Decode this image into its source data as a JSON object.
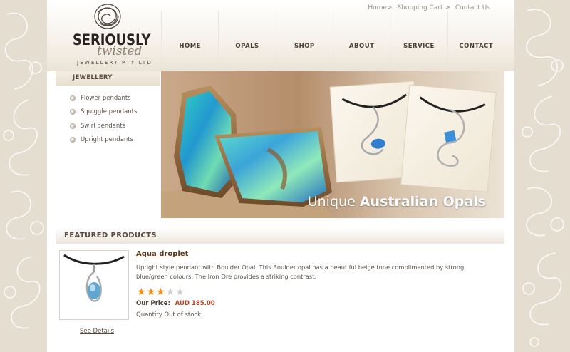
{
  "brand": {
    "line1": "SERIOUSLY",
    "line2": "twisted",
    "line3": "JEWELLERY PTY LTD"
  },
  "util_links": [
    {
      "label": "Home>"
    },
    {
      "label": "Shopping Cart >"
    },
    {
      "label": "Contact Us"
    }
  ],
  "nav": [
    {
      "label": "HOME"
    },
    {
      "label": "OPALS"
    },
    {
      "label": "SHOP"
    },
    {
      "label": "ABOUT"
    },
    {
      "label": "SERVICE"
    },
    {
      "label": "CONTACT"
    }
  ],
  "sidebar": {
    "heading": "JEWELLERY",
    "items": [
      {
        "label": "Flower pendants"
      },
      {
        "label": "Squiggle pendants"
      },
      {
        "label": "Swirl pendants"
      },
      {
        "label": "Upright pendants"
      }
    ]
  },
  "banner": {
    "text_light": "Unique ",
    "text_bold": "Australian Opals"
  },
  "featured": {
    "heading": "FEATURED PRODUCTS",
    "product": {
      "title": "Aqua droplet",
      "description": "Upright style pendant with Boulder Opal. This Boulder opal has a beautiful beige tone complimented by strong blue/green colours. The Iron Ore provides a striking contrast.",
      "rating": 3,
      "rating_max": 5,
      "price_label": "Our Price:",
      "price_value": "AUD 185.00",
      "quantity": "Quantity Out of stock",
      "see_details": "See Details"
    }
  },
  "colors": {
    "accent_price": "#b0432a",
    "star_on": "#f08a14",
    "star_off": "#cfcfcf"
  }
}
